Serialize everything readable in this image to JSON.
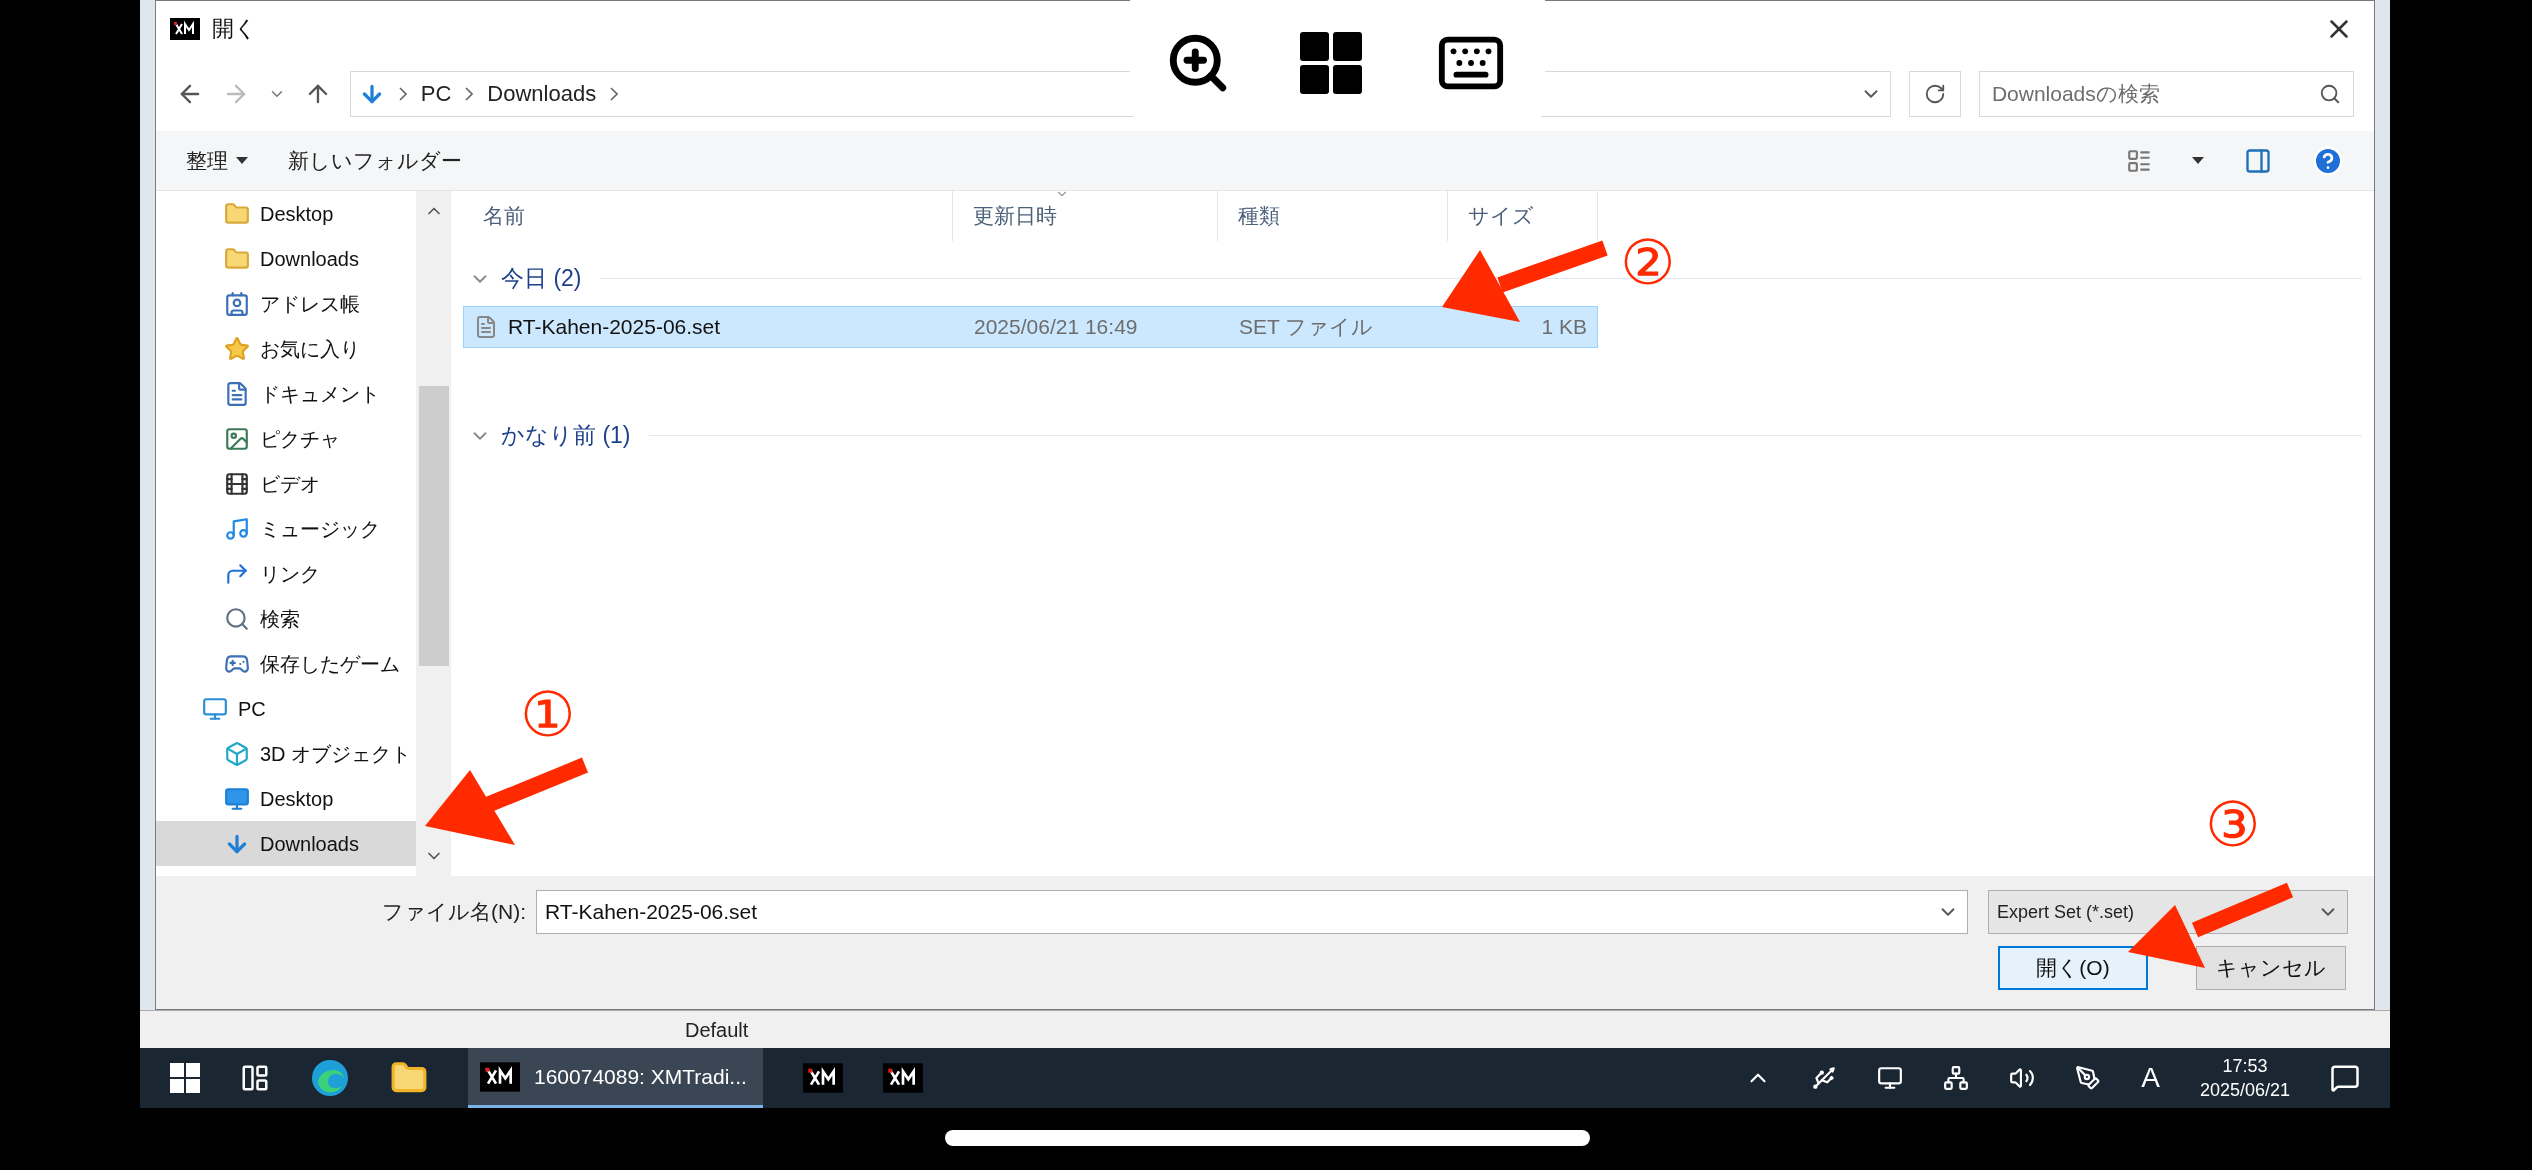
{
  "dialog": {
    "title": "開く"
  },
  "address_bar": {
    "path": [
      "PC",
      "Downloads"
    ],
    "search_placeholder": "Downloadsの検索"
  },
  "toolbar": {
    "organize": "整理",
    "new_folder": "新しいフォルダー"
  },
  "sidebar": {
    "partial_group": [
      {
        "label": "Desktop",
        "kind": "folder",
        "selected": false
      },
      {
        "label": "Downloads",
        "kind": "folder",
        "selected": false
      },
      {
        "label": "アドレス帳",
        "kind": "contacts",
        "selected": false
      },
      {
        "label": "お気に入り",
        "kind": "star",
        "selected": false
      },
      {
        "label": "ドキュメント",
        "kind": "document",
        "selected": false
      },
      {
        "label": "ピクチャ",
        "kind": "picture",
        "selected": false
      },
      {
        "label": "ビデオ",
        "kind": "video",
        "selected": false
      },
      {
        "label": "ミュージック",
        "kind": "music",
        "selected": false
      },
      {
        "label": "リンク",
        "kind": "link",
        "selected": false
      },
      {
        "label": "検索",
        "kind": "search",
        "selected": false
      },
      {
        "label": "保存したゲーム",
        "kind": "games",
        "selected": false
      }
    ],
    "items": [
      {
        "label": "PC",
        "kind": "pc",
        "selected": false,
        "children": [
          {
            "label": "3D オブジェクト",
            "kind": "cube",
            "selected": false
          },
          {
            "label": "Desktop",
            "kind": "desktop",
            "selected": false
          },
          {
            "label": "Downloads",
            "kind": "download",
            "selected": true
          }
        ]
      }
    ]
  },
  "file_list": {
    "columns": [
      {
        "label": "名前",
        "sorted": false
      },
      {
        "label": "更新日時",
        "sorted": true
      },
      {
        "label": "種類",
        "sorted": false
      },
      {
        "label": "サイズ",
        "sorted": false
      }
    ],
    "groups": [
      {
        "label": "今日 (2)",
        "expanded": true,
        "rows": [
          {
            "name": "RT-Kahen-2025-06.set",
            "modified": "2025/06/21 16:49",
            "type": "SET ファイル",
            "size": "1 KB",
            "selected": true
          }
        ]
      },
      {
        "label": "かなり前 (1)",
        "expanded": true
      }
    ]
  },
  "footer": {
    "filename_label": "ファイル名(N):",
    "filename_value": "RT-Kahen-2025-06.set",
    "filter": "Expert Set (*.set)",
    "buttons": [
      {
        "label": "開く(O)",
        "default": true
      },
      {
        "label": "キャンセル",
        "default": false
      }
    ]
  },
  "background_app": {
    "status_text": "Default"
  },
  "taskbar": {
    "window_button": {
      "label": "160074089: XMTradi...",
      "active": true
    },
    "ime": "A",
    "time": "17:53",
    "date": "2025/06/21"
  },
  "annotations": [
    {
      "label": "①"
    },
    {
      "label": "②"
    },
    {
      "label": "③"
    }
  ]
}
